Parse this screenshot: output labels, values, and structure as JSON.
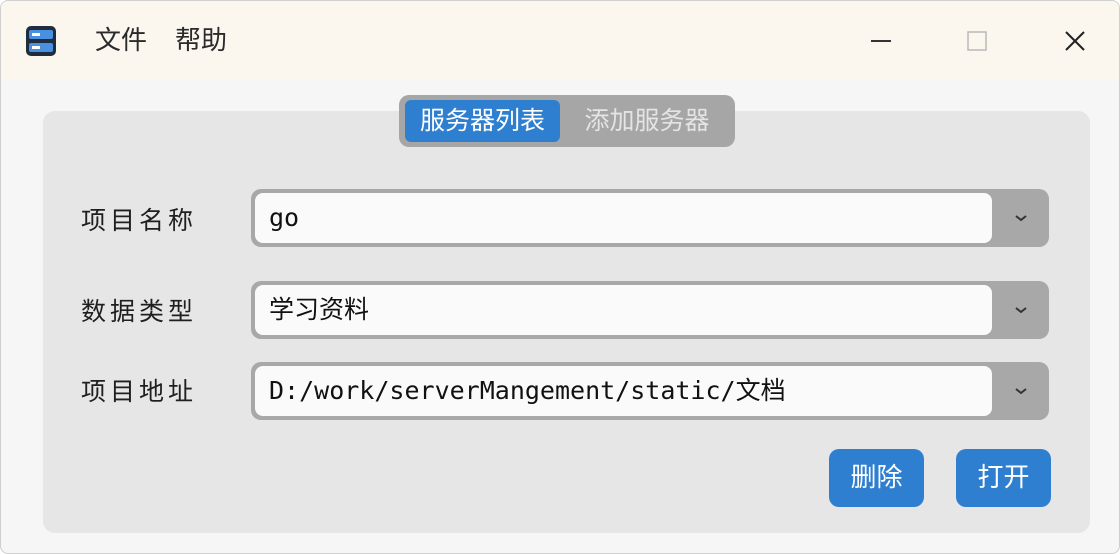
{
  "menu": {
    "file": "文件",
    "help": "帮助"
  },
  "window_controls": {
    "minimize": "minimize-icon",
    "maximize": "maximize-icon",
    "close": "close-icon"
  },
  "tabs": [
    {
      "label": "服务器列表",
      "active": true
    },
    {
      "label": "添加服务器",
      "active": false
    }
  ],
  "form": {
    "project_name": {
      "label": "项目名称",
      "value": "go"
    },
    "data_type": {
      "label": "数据类型",
      "value": "学习资料"
    },
    "project_path": {
      "label": "项目地址",
      "value": "D:/work/serverMangement/static/文档"
    }
  },
  "buttons": {
    "delete": "删除",
    "open": "打开"
  },
  "colors": {
    "accent": "#2f7fd1",
    "titlebar": "#fbf7ef",
    "panel": "#e6e6e6"
  }
}
